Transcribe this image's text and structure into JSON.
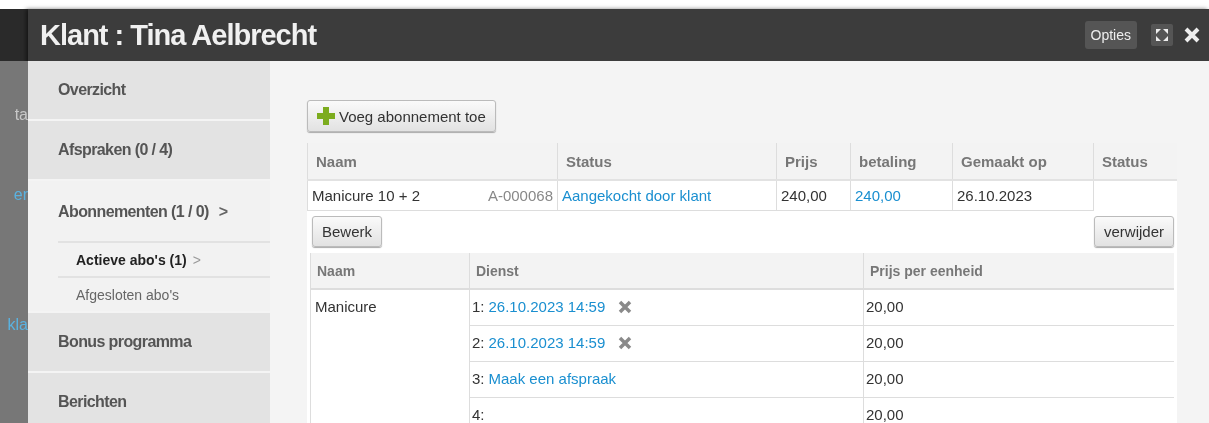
{
  "background_fragments": [
    "ta",
    "er",
    "kla"
  ],
  "window": {
    "title": "Klant : Tina Aelbrecht",
    "options_button": "Opties"
  },
  "sidebar": {
    "items": [
      {
        "label": "Overzicht",
        "selected": false
      },
      {
        "label": "Afspraken (0 / 4)",
        "selected": false
      },
      {
        "label": "Abonnementen (1 / 0)",
        "selected": true,
        "chevron": ">",
        "children": [
          {
            "label": "Actieve abo's (1)",
            "selected": true,
            "chevron": ">"
          },
          {
            "label": "Afgesloten abo's",
            "selected": false
          }
        ]
      },
      {
        "label": "Bonus programma",
        "selected": false
      },
      {
        "label": "Berichten",
        "selected": false
      }
    ]
  },
  "add_button": "Voeg abonnement toe",
  "subscriptions": {
    "columns": [
      "Naam",
      "Status",
      "Prijs",
      "betaling",
      "Gemaakt op",
      "Status"
    ],
    "rows": [
      {
        "name": "Manicure 10 + 2",
        "code": "A-000068",
        "status": "Aangekocht door klant",
        "price": "240,00",
        "payment": "240,00",
        "created": "26.10.2023"
      }
    ],
    "edit_button": "Bewerk",
    "delete_button": "verwijder"
  },
  "services": {
    "columns": [
      "Naam",
      "Dienst",
      "Prijs per eenheid"
    ],
    "name": "Manicure",
    "rows": [
      {
        "index": "1:",
        "link": "26.10.2023 14:59",
        "removable": true,
        "price": "20,00"
      },
      {
        "index": "2:",
        "link": "26.10.2023 14:59",
        "removable": true,
        "price": "20,00"
      },
      {
        "index": "3:",
        "link": "Maak een afspraak",
        "removable": false,
        "price": "20,00"
      },
      {
        "index": "4:",
        "link": "",
        "removable": false,
        "price": "20,00"
      }
    ]
  }
}
